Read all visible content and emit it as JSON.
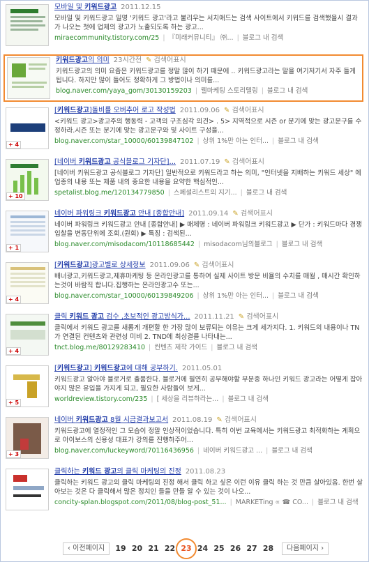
{
  "results": [
    {
      "title": "모바일 및 키워드광고",
      "title_parts": [
        {
          "t": "모바일 및 "
        },
        {
          "t": "키워드광고",
          "b": 1
        }
      ],
      "date": "2011.12.15",
      "tag": "",
      "snippet": "모바일 및 키워드광고 일명 '키워드 광고'라고 불리우는 서치애드는 검색 사이트에서 키워드를 검색했을시 결과가 나오는 첫에 업체의 광고가 노출되도록 하는 광고...",
      "url": "miraecommunity.tistory.com/25",
      "source": "『미래커뮤니티』 ㈜...",
      "blog_link": "블로그 내 검색",
      "badge": ""
    },
    {
      "title": "키워드광고의 의미",
      "title_parts": [
        {
          "t": "키워드광고",
          "b": 1
        },
        {
          "t": "의 의미"
        }
      ],
      "date": "23시간전",
      "tag": "검색어표시",
      "snippet": "키워드광고의 의미 요즘은 키워드광고를 정말 많이 하기 때문에 .. 키워드광고라는 말을 여기저기서 자주 들게 됩니다. 하지만 많이 들어도 정확하게 그 방법이나 의미를...",
      "url": "blog.naver.com/yaya_gom/30130159203",
      "source": "웰마케팅 스토리텔링",
      "blog_link": "블로그 내 검색",
      "badge": ""
    },
    {
      "title": "[키워드광고]돌비를 오버추어 로고 작성법",
      "title_parts": [
        {
          "t": "["
        },
        {
          "t": "키워드광고",
          "b": 1
        },
        {
          "t": "]돌비를 오버추어 로고 작성법"
        }
      ],
      "date": "2011.09.06",
      "tag": "검색어표시",
      "snippet": "<키워드 광고>광고주의 행동력 - 고객의 구조심각 의견> . 5> 지역적으로 시즌 or 분기에 맞는 광고문구를 수정하라.시즌 또는 분기에 맞는 광고문구와 및 사이트 구성을...",
      "url": "blog.naver.com/star_10000/60139847102",
      "source": "상위 1%만 아는 인터...",
      "blog_link": "블로그 내 검색",
      "badge": "4"
    },
    {
      "title": "[네이버 키워드광고 공식블로그 기자단] ...",
      "title_parts": [
        {
          "t": "[네이버 "
        },
        {
          "t": "키워드광고",
          "b": 1
        },
        {
          "t": " 공식블로그 기자단]..."
        }
      ],
      "date": "2011.07.19",
      "tag": "검색어표시",
      "snippet": "[네이버 키워드광고 공식블로그 기자단] 일반적으로 키워드라고 하는 의미, \"인터넷을 지배하는 키워드 세상\" 에 업종의 내용 또는 제품 내의 중요한 내용을 요약한 핵심적인...",
      "url": "spetalist.blog.me/120134779850",
      "source": "스페셜리스트의 지기...",
      "blog_link": "블로그 내 검색",
      "badge": "10"
    },
    {
      "title": "네이버 파워링크 키워드광고 안내 [종합안내]",
      "title_parts": [
        {
          "t": "네이버 파워링크 "
        },
        {
          "t": "키워드광고",
          "b": 1
        },
        {
          "t": " 안내 [종합안내]"
        }
      ],
      "date": "2011.09.14",
      "tag": "검색어표시",
      "snippet": "네이버 파워링크 키워드광고 안내 [종합안내] ▶ 매체명 : 네이버 파워링크 키워드광고 ▶ 단가 : 키워드마다 경쟁입찰을 변동단위에 조회.(원회) ▶ 특징 : 검색된...",
      "url": "blog.naver.com/misodacom/10118685442",
      "source": "misodacom님의블로그",
      "blog_link": "블로그 내 검색",
      "badge": "1"
    },
    {
      "title": "[키워드광고]광고별로 상세정보",
      "title_parts": [
        {
          "t": "["
        },
        {
          "t": "키워드광고",
          "b": 1
        },
        {
          "t": "]광고별로 상세정보"
        }
      ],
      "date": "2011.09.06",
      "tag": "검색어표시",
      "snippet": "배너광고,키워드광고,제휴마케팅 등 온라인광고를 통하여 실제 사이트 방문 비율의 수치를 매월 , 매시간 확인하는것이 바람직 합니다.집행하는 온라인광고수 또는...",
      "url": "blog.naver.com/star_10000/60139849206",
      "source": "상위 1%만 아는 인터...",
      "blog_link": "블로그 내 검색",
      "badge": "4"
    },
    {
      "title": "클릭 키워드 광고 검수 ,초보적인 광고방식가...",
      "title_parts": [
        {
          "t": "클릭 "
        },
        {
          "t": "키워드 광고",
          "b": 1
        },
        {
          "t": " 검수 ,초보적인 광고방식가..."
        }
      ],
      "date": "2011.11.21",
      "tag": "검색어표시",
      "snippet": "클릭에서 키워드 광고를 새롭게 개편할 한 가장 많이 보류되는 이유는 크게 세가지다. 1. 키워드의 내용이나 TN 가 연결된 컨텐츠와 관련성 미비 2. TND에 최상결를 나타내는...",
      "url": "tnct.blog.me/80129283410",
      "source": "컨텐츠 제작 가이드",
      "blog_link": "블로그 내 검색",
      "badge": "4"
    },
    {
      "title": "[키워드광고] 키워드광고에 대해 공부하기.",
      "title_parts": [
        {
          "t": "["
        },
        {
          "t": "키워드광고",
          "b": 1
        },
        {
          "t": "] "
        },
        {
          "t": "키워드광고",
          "b": 1
        },
        {
          "t": "에 대해 공부하기."
        }
      ],
      "date": "2011.05.01",
      "tag": "",
      "snippet": "키워드광고 알아야 블로거로 출품한다. 블로거에 필연히 공부해야할 부분중 하나인 키워드 광고라는 어떻게 잡아야지 많은 유입을 가지게 되고, 필요한 사람들이 보게...",
      "url": "worldreview.tistory.com/235",
      "source": "[ 세상을 리뷰하라는...",
      "blog_link": "블로그 내 검색",
      "badge": "5"
    },
    {
      "title": "네이버 키워드광고 8월 시금결과보고서",
      "title_parts": [
        {
          "t": "네이버 "
        },
        {
          "t": "키워드광고",
          "b": 1
        },
        {
          "t": " 8월 시금결과보고서"
        }
      ],
      "date": "2011.08.19",
      "tag": "검색어표시",
      "snippet": "키워드광고에 열정적인 그 모습이 정말 인상적이었습니다. 특히 이번 교육에서는 키워드광고 최적화하는 계획으로 아이보스의 신용성 대표가 강의를 진행하주어...",
      "url": "blog.naver.com/luckeyword/70116436956",
      "source": "네이버 키워드광고 ...",
      "blog_link": "블로그 내 검색",
      "badge": "3"
    },
    {
      "title": "클릭하는 키워드 광고의 클릭 마케팅의 진정",
      "title_parts": [
        {
          "t": "클릭하는 "
        },
        {
          "t": "키워드 광고",
          "b": 1
        },
        {
          "t": "의 클릭 마케팅의 진정"
        }
      ],
      "date": "2011.08.23",
      "tag": "",
      "snippet": "클릭하는 키워드 광고의 클릭 마케팅의 진정 해서 클릭 하고 싶은 이런 이유 클릭 하는 것 만큼 살아있음. 한번 살아보는 것은 다 클릭해서 많은 정치인 들을 만들 알 수 있는 것이 나오...",
      "url": "concity-splan.blogspot.com/2011/08/blog-post_51...",
      "source": "MARKETing ∝ ☎ CO...",
      "blog_link": "블로그 내 검색",
      "badge": ""
    }
  ],
  "pager": {
    "prev": "‹ 이전페이지",
    "next": "다음페이지 ›",
    "pages": [
      "19",
      "20",
      "21",
      "22",
      "23",
      "24",
      "25",
      "26",
      "27",
      "28"
    ],
    "current": "23"
  }
}
